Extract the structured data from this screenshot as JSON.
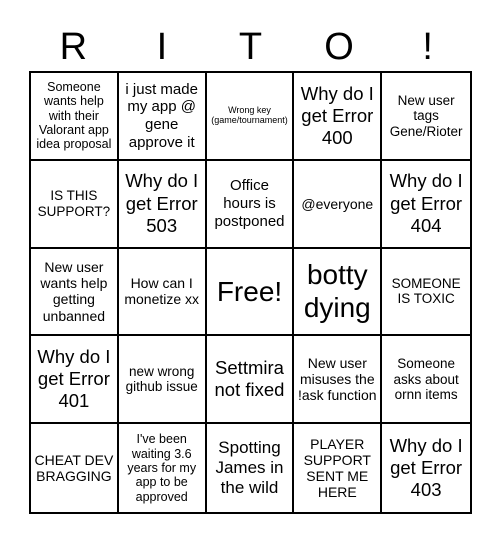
{
  "header": {
    "letters": [
      "R",
      "I",
      "T",
      "O",
      "!"
    ]
  },
  "board": {
    "rows": [
      [
        "Someone wants help with their Valorant app idea proposal",
        "i just made my app @ gene approve it",
        "Wrong key (game/tournament)",
        "Why do I get Error 400",
        "New user tags Gene/Rioter"
      ],
      [
        "IS THIS SUPPORT?",
        "Why do I get Error 503",
        "Office hours is postponed",
        "@everyone",
        "Why do I get Error 404"
      ],
      [
        "New user wants help getting unbanned",
        "How can I monetize xx",
        "Free!",
        "botty dying",
        "SOMEONE IS TOXIC"
      ],
      [
        "Why do I get Error 401",
        "new wrong github issue",
        "Settmira not fixed",
        "New user misuses the !ask function",
        "Someone asks about ornn items"
      ],
      [
        "CHEAT DEV BRAGGING",
        "I've been waiting 3.6 years for my app to be approved",
        "Spotting James in the wild",
        "PLAYER SUPPORT SENT ME HERE",
        "Why do I get Error 403"
      ]
    ]
  }
}
